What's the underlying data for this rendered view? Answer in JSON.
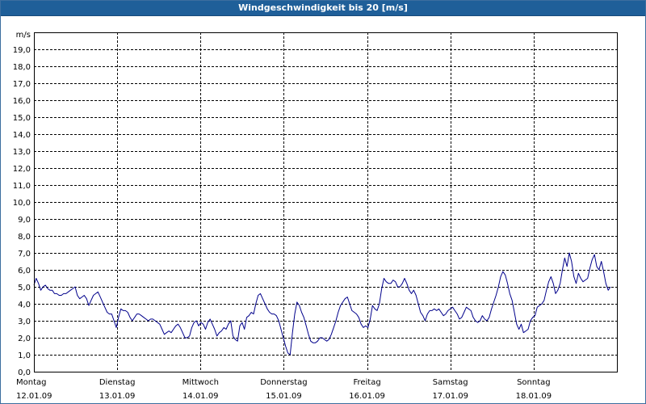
{
  "window": {
    "title": "Windgeschwindigkeit bis 20 [m/s]"
  },
  "chart_data": {
    "type": "line",
    "title": "Windgeschwindigkeit bis 20 [m/s]",
    "ylabel": "m/s",
    "xlabel": "",
    "ylim": [
      0,
      20
    ],
    "yticks": [
      "0,0",
      "1,0",
      "2,0",
      "3,0",
      "4,0",
      "5,0",
      "6,0",
      "7,0",
      "8,0",
      "9,0",
      "10,0",
      "11,0",
      "12,0",
      "13,0",
      "14,0",
      "15,0",
      "16,0",
      "17,0",
      "18,0",
      "19,0"
    ],
    "xlim": [
      "12.01.09 00:00",
      "19.01.09 00:00"
    ],
    "xticks": [
      {
        "day": "Montag",
        "date": "12.01.09"
      },
      {
        "day": "Dienstag",
        "date": "13.01.09"
      },
      {
        "day": "Mittwoch",
        "date": "14.01.09"
      },
      {
        "day": "Donnerstag",
        "date": "15.01.09"
      },
      {
        "day": "Freitag",
        "date": "16.01.09"
      },
      {
        "day": "Samstag",
        "date": "17.01.09"
      },
      {
        "day": "Sonntag",
        "date": "18.01.09"
      }
    ],
    "grid": true,
    "line_color": "#00008b",
    "series": [
      {
        "x_start": "12.01.09 00:00",
        "x_end": "19.01.09 00:00",
        "values": [
          5.1,
          5.5,
          5.2,
          4.8,
          5.0,
          5.1,
          4.9,
          4.8,
          4.8,
          4.6,
          4.6,
          4.5,
          4.5,
          4.6,
          4.6,
          4.7,
          4.8,
          4.9,
          5.0,
          4.5,
          4.3,
          4.4,
          4.5,
          4.3,
          3.9,
          4.2,
          4.5,
          4.6,
          4.7,
          4.4,
          4.1,
          3.8,
          3.5,
          3.4,
          3.4,
          3.0,
          2.6,
          3.2,
          3.7,
          3.6,
          3.6,
          3.5,
          3.2,
          3.0,
          3.2,
          3.4,
          3.4,
          3.3,
          3.2,
          3.1,
          3.0,
          3.1,
          3.1,
          3.0,
          2.9,
          2.8,
          2.5,
          2.2,
          2.3,
          2.4,
          2.3,
          2.5,
          2.7,
          2.8,
          2.6,
          2.3,
          2.0,
          2.0,
          2.1,
          2.6,
          2.9,
          3.0,
          2.7,
          2.9,
          2.8,
          2.5,
          2.9,
          3.1,
          2.8,
          2.5,
          2.1,
          2.3,
          2.4,
          2.6,
          2.5,
          2.8,
          3.0,
          2.1,
          1.9,
          1.8,
          2.7,
          2.9,
          2.5,
          3.2,
          3.3,
          3.5,
          3.4,
          4.0,
          4.5,
          4.6,
          4.3,
          4.0,
          3.7,
          3.5,
          3.4,
          3.4,
          3.3,
          3.0,
          2.5,
          2.0,
          1.5,
          1.1,
          1.0,
          2.3,
          3.4,
          4.1,
          3.9,
          3.5,
          3.2,
          2.7,
          2.2,
          1.8,
          1.7,
          1.7,
          1.8,
          2.0,
          2.0,
          1.9,
          1.8,
          1.9,
          2.2,
          2.6,
          3.0,
          3.5,
          3.9,
          4.1,
          4.3,
          4.4,
          4.0,
          3.6,
          3.5,
          3.4,
          3.2,
          2.8,
          2.6,
          2.7,
          2.6,
          3.1,
          3.9,
          3.7,
          3.6,
          4.0,
          4.9,
          5.5,
          5.3,
          5.2,
          5.2,
          5.4,
          5.3,
          5.0,
          5.0,
          5.2,
          5.5,
          5.2,
          4.8,
          4.6,
          4.8,
          4.5,
          4.0,
          3.5,
          3.3,
          3.0,
          3.4,
          3.6,
          3.6,
          3.7,
          3.6,
          3.7,
          3.5,
          3.3,
          3.4,
          3.6,
          3.7,
          3.8,
          3.6,
          3.4,
          3.1,
          3.2,
          3.5,
          3.8,
          3.7,
          3.6,
          3.2,
          3.0,
          2.9,
          3.0,
          3.3,
          3.1,
          3.0,
          3.2,
          3.7,
          4.1,
          4.5,
          5.0,
          5.6,
          5.9,
          5.7,
          5.2,
          4.6,
          4.2,
          3.5,
          2.8,
          2.5,
          2.8,
          2.3,
          2.4,
          2.5,
          3.0,
          3.2,
          3.3,
          3.8,
          3.9,
          4.0,
          4.2,
          4.8,
          5.3,
          5.6,
          5.2,
          4.6,
          4.8,
          5.2,
          6.0,
          6.7,
          6.2,
          7.0,
          6.5,
          5.6,
          5.2,
          5.8,
          5.5,
          5.3,
          5.4,
          5.5,
          6.1,
          6.6,
          6.9,
          6.2,
          6.0,
          6.5,
          5.9,
          5.2,
          4.8,
          5.0
        ]
      }
    ]
  }
}
